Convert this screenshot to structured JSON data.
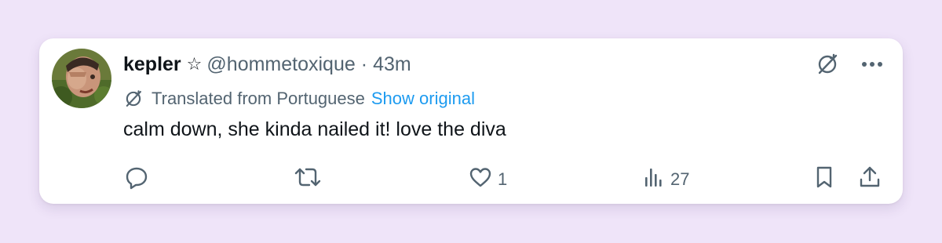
{
  "tweet": {
    "author_name": "kepler",
    "badge_icon": "star-icon",
    "handle": "@hommetoxique",
    "separator": "·",
    "time": "43m",
    "translation_label": "Translated from Portuguese",
    "show_original": "Show original",
    "text": "calm down, she kinda nailed it! love the diva"
  },
  "actions": {
    "reply_icon": "reply-icon",
    "retweet_icon": "retweet-icon",
    "like_icon": "heart-icon",
    "like_count": "1",
    "views_icon": "views-icon",
    "views_count": "27",
    "bookmark_icon": "bookmark-icon",
    "share_icon": "share-icon"
  },
  "colors": {
    "background": "#efe4f9",
    "text_primary": "#0f1419",
    "text_secondary": "#536471",
    "link": "#1d9bf0"
  }
}
